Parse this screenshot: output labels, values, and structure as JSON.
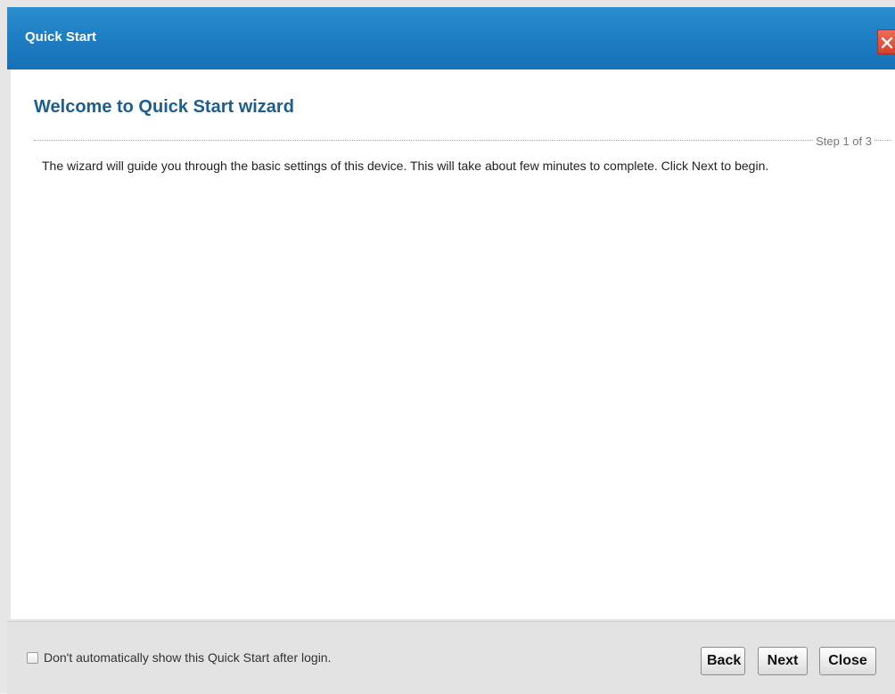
{
  "window": {
    "title": "Quick Start",
    "close_icon": "close-x-icon",
    "accent_color": "#1f7fc4"
  },
  "main": {
    "heading": "Welcome to Quick Start wizard",
    "step": "Step 1 of 3",
    "description": "The wizard will guide you through the basic settings of this device. This will take about few minutes to complete. Click Next to begin."
  },
  "footer": {
    "checkbox_label": "Don't automatically show this Quick Start after login.",
    "checkbox_checked": false,
    "back_label": "Back",
    "next_label": "Next",
    "close_label": "Close"
  }
}
